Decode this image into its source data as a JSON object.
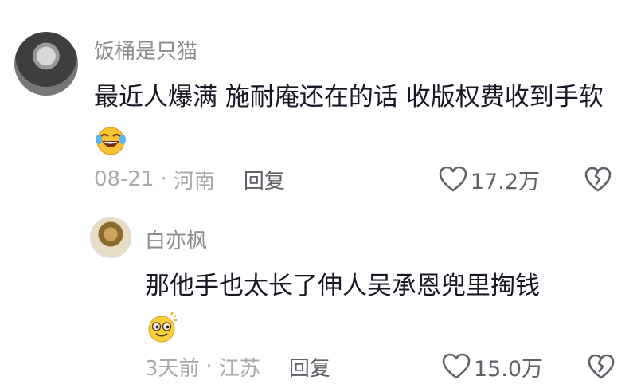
{
  "comments": [
    {
      "username": "饭桶是只猫",
      "text": "最近人爆满 施耐庵还在的话 收版权费收到手软",
      "emoji": "laugh-crying-emoji",
      "date": "08-21",
      "separator": "·",
      "location": "河南",
      "reply_label": "回复",
      "likes": "17.2万"
    },
    {
      "username": "白亦枫",
      "text": "那他手也太长了伸人吴承恩兜里掏钱",
      "emoji": "dizzy-smile-emoji",
      "date": "3天前",
      "separator": "·",
      "location": "江苏",
      "reply_label": "回复",
      "likes": "15.0万"
    }
  ],
  "colors": {
    "text_primary": "#161823",
    "text_secondary": "#8a8b91",
    "meta": "#a8a9ae",
    "action": "#5f6068"
  }
}
